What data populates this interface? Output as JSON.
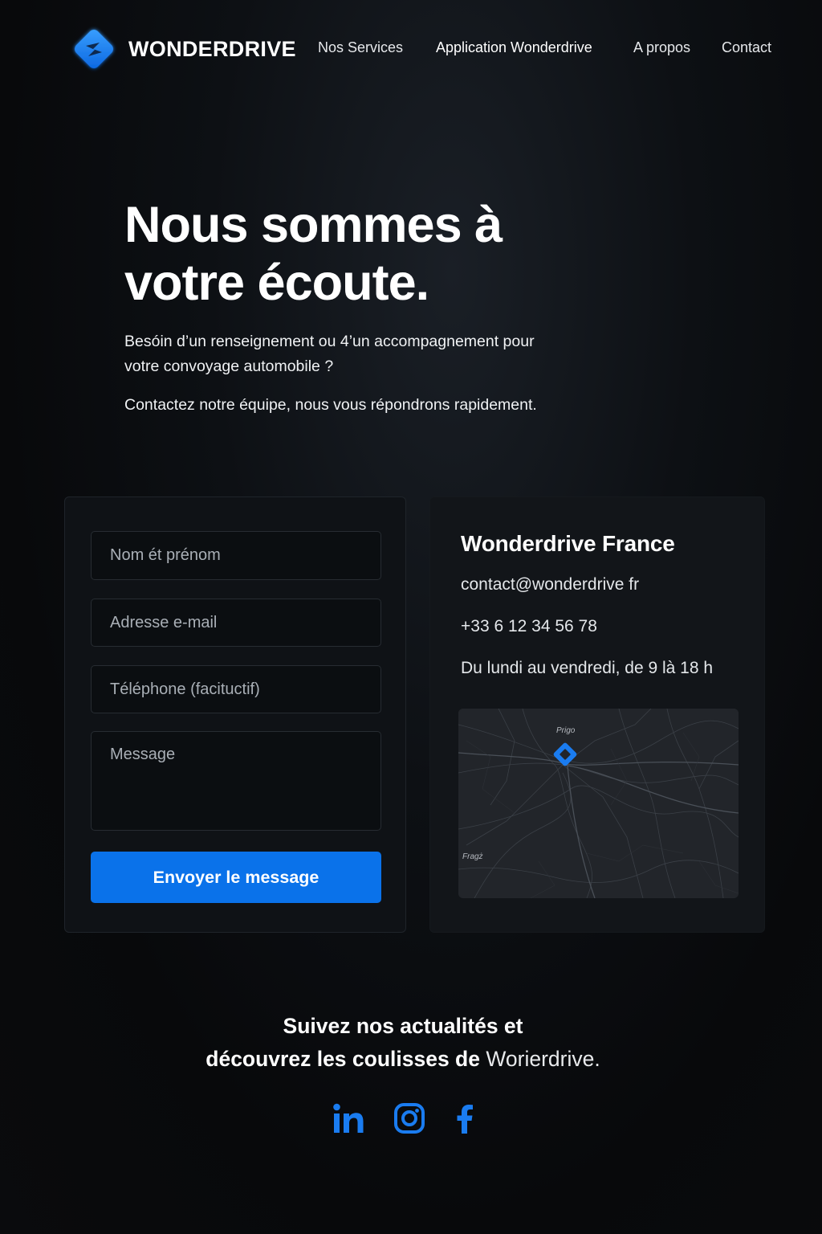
{
  "header": {
    "brand": "WONDERDRIVE",
    "nav": [
      {
        "label": "Nos Services"
      },
      {
        "label": "Application Wonderdrive"
      },
      {
        "label": "A propos"
      },
      {
        "label": "Contact"
      }
    ]
  },
  "hero": {
    "title_line1": "Nous sommes à",
    "title_line2": "votre écoute.",
    "subtitle_line1": "Besóin d’un renseignement ou 4’un accompagnement pour",
    "subtitle_line2": "votre convoyage automobile ?",
    "subtitle2": "Contactez notre équipe, nous vous répondrons rapidement."
  },
  "form": {
    "name_placeholder": "Nom ét prénom",
    "email_placeholder": "Adresse e-mail",
    "phone_placeholder": "Téléphone (facituctif)",
    "message_placeholder": "Message",
    "submit_label": "Envoyer le message"
  },
  "info": {
    "title": "Wonderdrive France",
    "email": "contact@wonderdrive fr",
    "phone": "+33 6 12 34 56 78",
    "hours": "Du lundi au vendredi, de 9 là 18 h",
    "map": {
      "label_top": "Prigo",
      "label_bottom": "Fragż"
    }
  },
  "footer": {
    "follow_line1": "Suivez nos actualités et",
    "follow_line2_prefix": "découvrez les coulisses de ",
    "follow_line2_brand": "Worierdrive.",
    "socials": [
      {
        "icon": "linkedin-icon"
      },
      {
        "icon": "instagram-icon"
      },
      {
        "icon": "facebook-icon"
      }
    ]
  },
  "colors": {
    "accent": "#0a72ea",
    "background": "#0a0c0f",
    "card": "#0f1216"
  }
}
